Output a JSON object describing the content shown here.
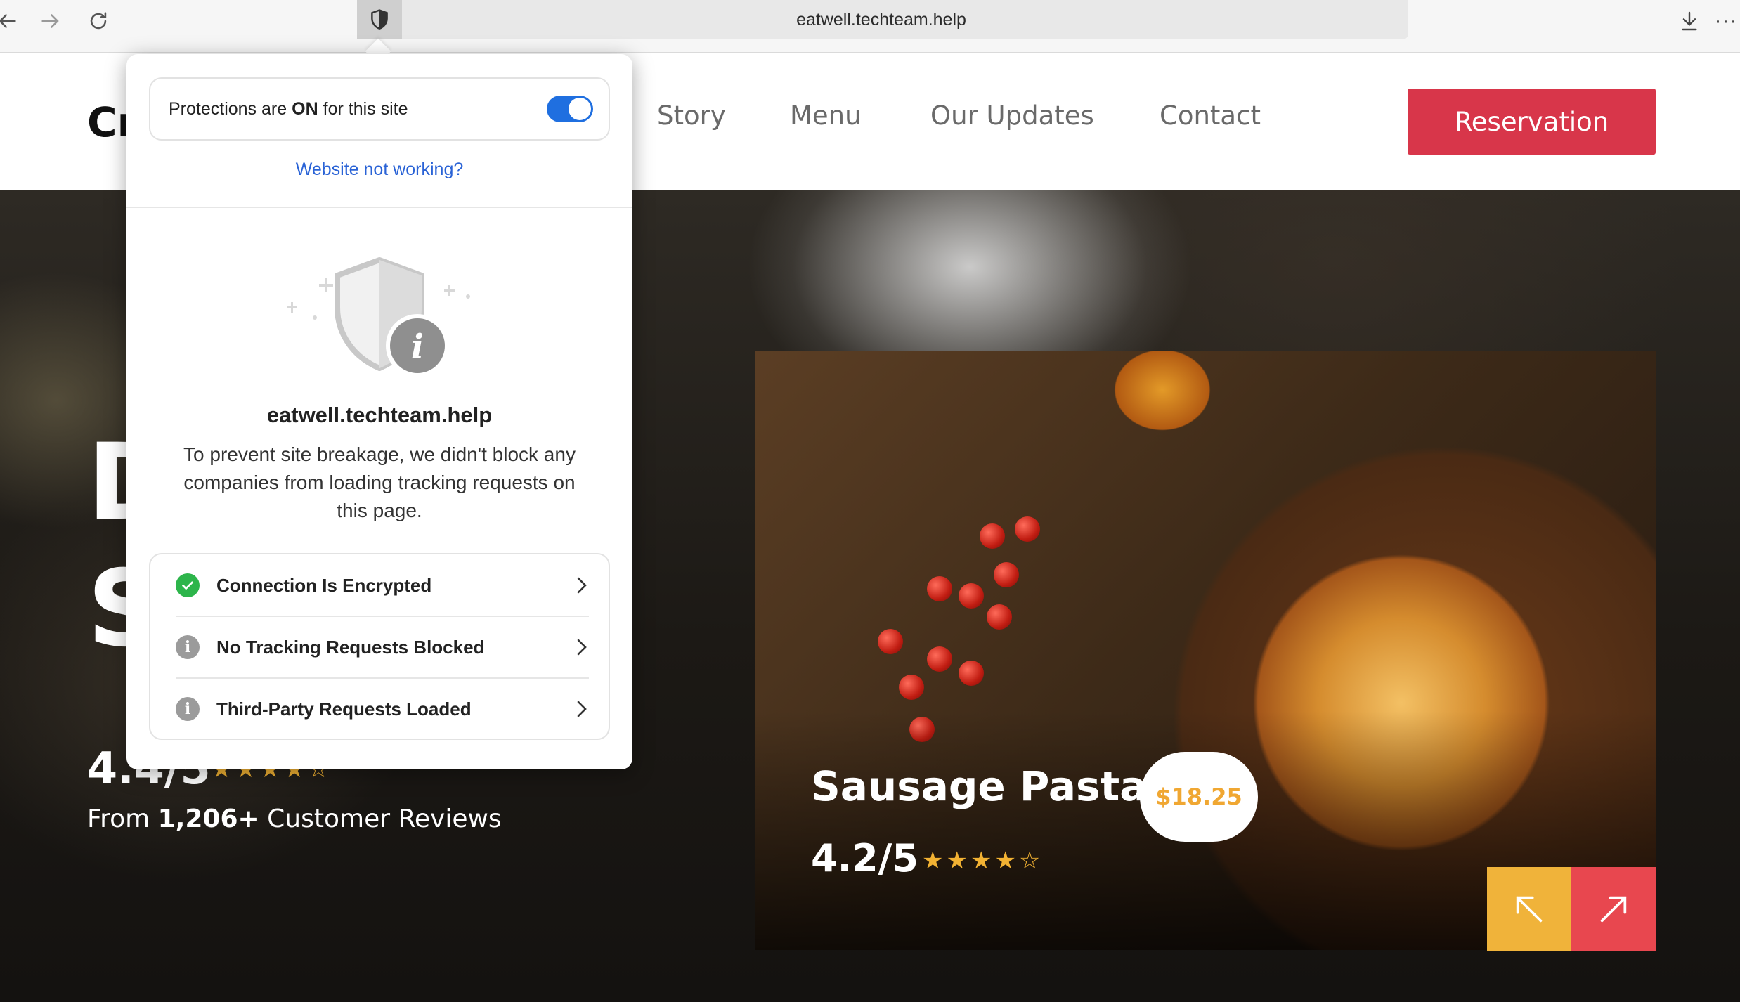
{
  "browser": {
    "url": "eatwell.techteam.help",
    "more_label": "···"
  },
  "site": {
    "logo_text": "Cr",
    "nav": [
      "Story",
      "Menu",
      "Our Updates",
      "Contact"
    ],
    "reservation_label": "Reservation"
  },
  "hero": {
    "headline_line1": "D",
    "headline_line2": "S",
    "rating": "4.4/5",
    "stars": "★★★★☆",
    "reviews_prefix": "From",
    "reviews_count": "1,206+",
    "reviews_suffix": "Customer Reviews"
  },
  "food_card": {
    "title": "Sausage Pasta",
    "price": "$18.25",
    "rating": "4.2/5",
    "stars": "★★★★☆",
    "prev_color": "#f0b33a",
    "next_color": "#e8474f"
  },
  "popover": {
    "protections_prefix": "Protections are",
    "protections_state": "ON",
    "protections_suffix": "for this site",
    "toggle_on": true,
    "not_working_link": "Website not working?",
    "domain": "eatwell.techteam.help",
    "description": "To prevent site breakage, we didn't block any companies from loading tracking requests on this page.",
    "rows": [
      {
        "label": "Connection Is Encrypted",
        "icon": "check-circle-icon",
        "color": "#2db54b"
      },
      {
        "label": "No Tracking Requests Blocked",
        "icon": "info-icon",
        "color": "#9b9b9b"
      },
      {
        "label": "Third-Party Requests Loaded",
        "icon": "info-icon",
        "color": "#9b9b9b"
      }
    ]
  }
}
